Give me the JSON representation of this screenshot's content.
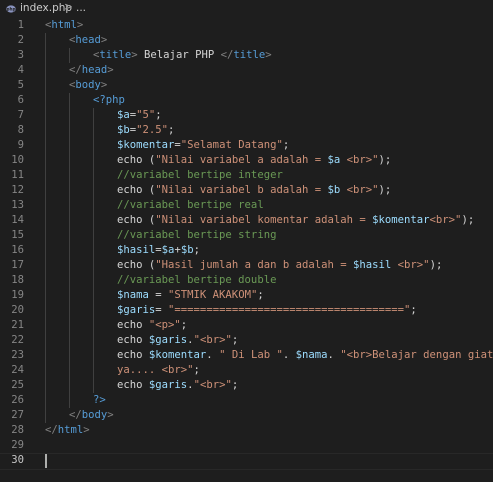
{
  "breadcrumb": {
    "file_icon": "php-file-icon",
    "file_name": "index.php",
    "separator": ">",
    "more": "..."
  },
  "editor": {
    "lines": [
      {
        "n": "1"
      },
      {
        "n": "2"
      },
      {
        "n": "3"
      },
      {
        "n": "4"
      },
      {
        "n": "5"
      },
      {
        "n": "6"
      },
      {
        "n": "7"
      },
      {
        "n": "8"
      },
      {
        "n": "9"
      },
      {
        "n": "10"
      },
      {
        "n": "11"
      },
      {
        "n": "12"
      },
      {
        "n": "13"
      },
      {
        "n": "14"
      },
      {
        "n": "15"
      },
      {
        "n": "16"
      },
      {
        "n": "17"
      },
      {
        "n": "18"
      },
      {
        "n": "19"
      },
      {
        "n": "20"
      },
      {
        "n": "21"
      },
      {
        "n": "22"
      },
      {
        "n": "23"
      },
      {
        "n": "24"
      },
      {
        "n": "25"
      },
      {
        "n": "26"
      },
      {
        "n": "27"
      },
      {
        "n": "28"
      },
      {
        "n": "29"
      },
      {
        "n": "30"
      }
    ],
    "code": {
      "l1_tag": "html",
      "l2_tag": "head",
      "l3_tag": "title",
      "l3_text": " Belajar PHP ",
      "l3_tag_close": "title",
      "l4_tag": "head",
      "l5_tag": "body",
      "l6_php": "<?php",
      "l7_var": "$a",
      "l7_str": "\"5\"",
      "l8_var": "$b",
      "l8_str": "\"2.5\"",
      "l9_var": "$komentar",
      "l9_str": "\"Selamat Datang\"",
      "l10_echo": "echo (",
      "l10_str1": "\"Nilai variabel a adalah = ",
      "l10_var": "$a",
      "l10_str2": " <br>\"",
      "l10_end": ");",
      "l11_cmt": "//variabel bertipe integer",
      "l12_echo": "echo (",
      "l12_str1": "\"Nilai variabel b adalah = ",
      "l12_var": "$b",
      "l12_str2": " <br>\"",
      "l12_end": ");",
      "l13_cmt": "//variabel bertipe real",
      "l14_echo": "echo (",
      "l14_str1": "\"Nilai variabel komentar adalah = ",
      "l14_var": "$komentar",
      "l14_str2": "<br>\"",
      "l14_end": ");",
      "l15_cmt": "//variabel bertipe string",
      "l16_var1": "$hasil",
      "l16_op1": "=",
      "l16_var2": "$a",
      "l16_op2": "+",
      "l16_var3": "$b",
      "l16_end": ";",
      "l17_echo": "echo (",
      "l17_str1": "\"Hasil jumlah a dan b adalah = ",
      "l17_var": "$hasil",
      "l17_str2": " <br>\"",
      "l17_end": ");",
      "l18_cmt": "//variabel bertipe double",
      "l19_var": "$nama",
      "l19_op": " = ",
      "l19_str": "\"STMIK AKAKOM\"",
      "l20_var": "$garis",
      "l20_op": "= ",
      "l20_str": "\"====================================\"",
      "l21_echo": "echo ",
      "l21_str": "\"<p>\"",
      "l22_echo": "echo ",
      "l22_var": "$garis",
      "l22_op": ".",
      "l22_str": "\"<br>\"",
      "l23_echo": "echo ",
      "l23_var1": "$komentar",
      "l23_op1": ". ",
      "l23_str1": "\" Di Lab \"",
      "l23_op2": ". ",
      "l23_var2": "$nama",
      "l23_op3": ". ",
      "l23_str2": "\"<br>Belajar dengan giat",
      "l24_str": "ya.... <br>\"",
      "l24_end": ";",
      "l25_echo": "echo ",
      "l25_var": "$garis",
      "l25_op": ".",
      "l25_str": "\"<br>\"",
      "l26_php": "?>",
      "l27_tag": "body",
      "l28_tag": "html"
    }
  },
  "colors": {
    "background": "#1e1e1e",
    "tag": "#569cd6",
    "variable": "#9cdcfe",
    "string": "#ce9178",
    "comment": "#6a9955",
    "line_number": "#858585"
  }
}
